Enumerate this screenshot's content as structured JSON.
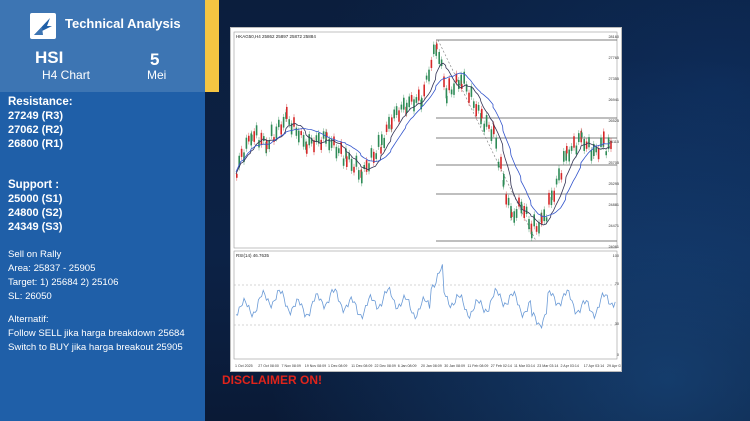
{
  "header": {
    "app_title": "Technical Analysis",
    "ticker": "HSI",
    "chart_timeframe": "H4 Chart",
    "date_day": "5",
    "date_month": "Mei"
  },
  "resistance": {
    "title": "Resistance:",
    "levels": [
      "27249 (R3)",
      "27062 (R2)",
      "26800 (R1)"
    ]
  },
  "support": {
    "title": "Support :",
    "levels": [
      "25000 (S1)",
      "24800 (S2)",
      "24349 (S3)"
    ]
  },
  "plan": {
    "line1": "Sell on Rally",
    "line2": "Area: 25837 - 25905",
    "line3": "Target: 1) 25684  2) 25106",
    "line4": "SL: 26050"
  },
  "alternatif": {
    "title": "Alternatif:",
    "line1": "Follow SELL jika harga breakdown 25684",
    "line2": "Switch to BUY jika harga breakout 25905"
  },
  "chart": {
    "symbol_label": "HKAG50,H4  25862 25897 25872 25884",
    "rsi_label": "RSI(14) 46.7635",
    "fib_labels": [
      "100.0 (28123)",
      "61.8 (26633)",
      "50.0 (26102)",
      "38.2 (25684)",
      "23.6 (25106)",
      "0.0 (24171)"
    ],
    "price_ticks": [
      "28160",
      "27765",
      "27355",
      "26941",
      "26525",
      "26115",
      "25705",
      "25295",
      "24881",
      "24471",
      "24061"
    ],
    "rsi_ticks": [
      "100",
      "70",
      "30",
      "0"
    ],
    "date_ticks": [
      "1 Oct 2025",
      "27 Oct 08:00",
      "7 Nov 08:09",
      "19 Nov 08:09",
      "1 Dec 08:09",
      "11 Dec 08:09",
      "22 Dec 08:09",
      "6 Jan 08:09",
      "20 Jan 08:09",
      "30 Jan 08:09",
      "11 Feb 08:09",
      "27 Feb 02:14",
      "11 Mar 03:14",
      "23 Mar 03:14",
      "2 Apr 03:14",
      "17 Apr 03:14",
      "29 Apr 03:14"
    ],
    "colors": {
      "bull": "#2e8b57",
      "bear": "#d62728",
      "ma1": "#333355",
      "ma2": "#3355cc",
      "rsi": "#6a9ad6",
      "fib": "#555555"
    }
  },
  "disclaimer": "DISCLAIMER ON!"
}
